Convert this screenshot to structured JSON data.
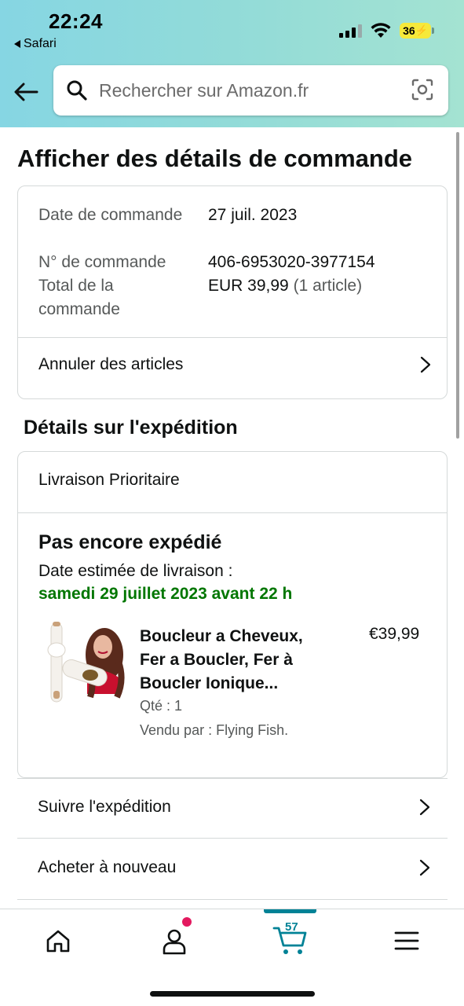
{
  "status_bar": {
    "time": "22:24",
    "back_app": "Safari",
    "battery": "36"
  },
  "search": {
    "placeholder": "Rechercher sur Amazon.fr"
  },
  "page": {
    "title": "Afficher des détails de commande"
  },
  "order": {
    "date_label": "Date de commande",
    "date_value": "27 juil. 2023",
    "number_label": "N° de commande",
    "number_value": "406-6953020-3977154",
    "total_label": "Total de la commande",
    "total_value": "EUR 39,99",
    "total_items": "(1 article)",
    "cancel_link": "Annuler des articles"
  },
  "shipping": {
    "section_title": "Détails sur l'expédition",
    "type": "Livraison Prioritaire",
    "status": "Pas encore expédié",
    "eta_label": "Date estimée de livraison :",
    "eta_date": "samedi 29 juillet 2023 avant 22 h"
  },
  "product": {
    "title_line1": "Boucleur a Cheveux,",
    "title_line2": "Fer a Boucler, Fer à",
    "title_line3": "Boucler Ionique...",
    "price": "€39,99",
    "qty": "Qté : 1",
    "seller": "Vendu par : Flying Fish."
  },
  "actions": {
    "track": "Suivre l'expédition",
    "buy_again": "Acheter à nouveau"
  },
  "bottom_nav": {
    "cart_count": "57",
    "items": [
      "home-icon",
      "account-icon",
      "cart-icon",
      "menu-icon"
    ]
  },
  "colors": {
    "accent_teal": "#008296",
    "delivery_green": "#007600",
    "notif_pink": "#e3195f",
    "header_gradient_start": "#86d6e3",
    "header_gradient_end": "#a4e3d2"
  }
}
